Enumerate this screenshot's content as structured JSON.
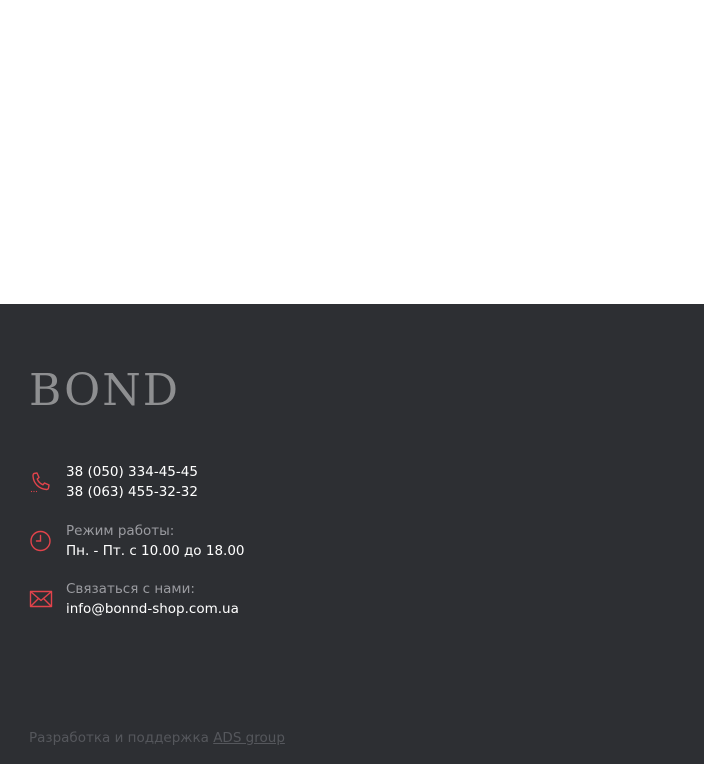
{
  "brand": {
    "logo_text": "BOND",
    "accent_color": "#e2434b"
  },
  "contacts": {
    "phones": [
      "38 (050) 334-45-45",
      "38 (063) 455-32-32"
    ],
    "hours_label": "Режим работы:",
    "hours_value": "Пн. - Пт. с 10.00 до 18.00",
    "email_label": "Связаться с нами:",
    "email_value": "info@bonnd-shop.com.ua",
    "icons": [
      "phone-icon",
      "clock-icon",
      "envelope-icon"
    ]
  },
  "credits": {
    "text": "Разработка и поддержка",
    "link_text": "ADS group"
  }
}
